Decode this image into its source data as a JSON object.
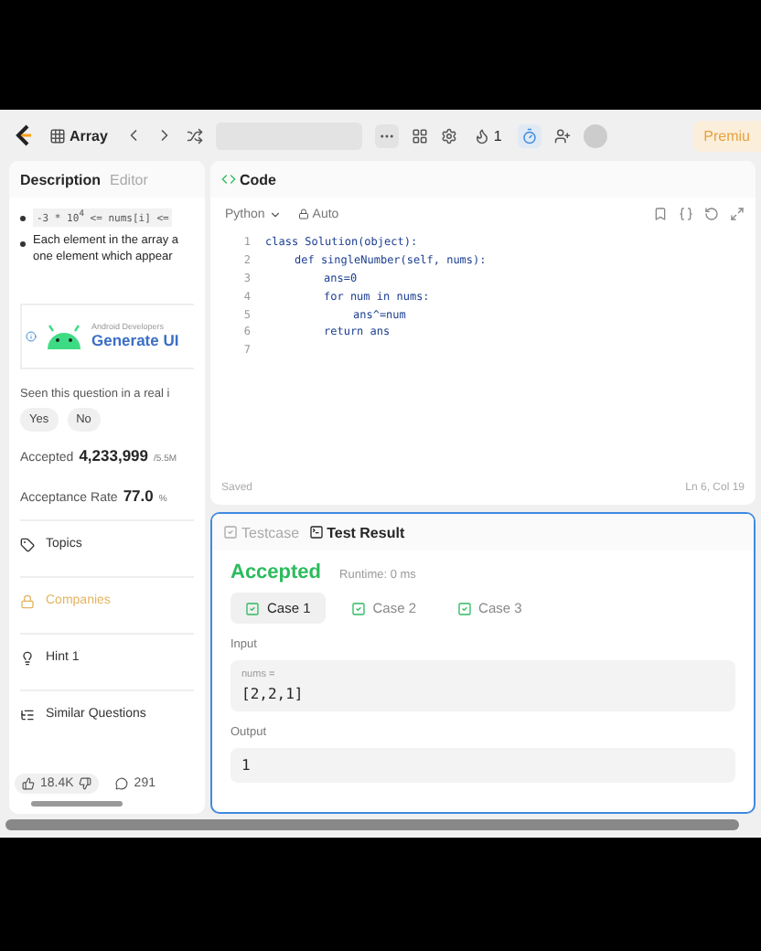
{
  "nav": {
    "problem_list": "Array",
    "streak": "1",
    "premium": "Premiu"
  },
  "left": {
    "tabs": [
      {
        "label": "Description",
        "selected": true
      },
      {
        "label": "Editor",
        "selected": false
      }
    ],
    "constraint": "-3 * 10$^{4}$ <= nums[i] <=",
    "bullet_lines": [
      "Each element in the array a",
      "one element which appear"
    ],
    "ad": {
      "sponsor": "Android Developers",
      "headline": "Generate UI"
    },
    "seen_question": "Seen this question in a real i",
    "answers": [
      "Yes",
      "No"
    ],
    "accepted": {
      "label": "Accepted",
      "value": "4,233,999",
      "total": "/5.5M"
    },
    "acceptance_rate": {
      "label": "Acceptance Rate",
      "value": "77.0",
      "unit": "%"
    },
    "sections": [
      {
        "label": "Topics",
        "kind": "topics",
        "locked": false
      },
      {
        "label": "Companies",
        "kind": "companies",
        "locked": true
      },
      {
        "label": "Hint 1",
        "kind": "hint",
        "locked": false
      },
      {
        "label": "Similar Questions",
        "kind": "similar",
        "locked": false
      }
    ],
    "likes": "18.4K",
    "comments": "291"
  },
  "code": {
    "title": "Code",
    "language": "Python",
    "mode": "Auto",
    "lines": [
      {
        "number": "1",
        "text": "class Solution(object):",
        "children": [
          {
            "number": "2",
            "text": "def singleNumber(self, nums):",
            "children": [
              {
                "number": "3",
                "text": "ans=0"
              },
              {
                "number": "4",
                "text": "for num in nums:",
                "children": [
                  {
                    "number": "5",
                    "text": "ans^=num"
                  }
                ]
              },
              {
                "number": "6",
                "text": "return ans"
              }
            ]
          }
        ]
      },
      {
        "number": "7"
      }
    ],
    "status": "Saved",
    "cursor": "Ln 6, Col 19"
  },
  "result": {
    "tabs": [
      {
        "label": "Testcase",
        "selected": false
      },
      {
        "label": "Test Result",
        "selected": true
      }
    ],
    "verdict": "Accepted",
    "runtime": "Runtime: 0 ms",
    "cases": [
      {
        "label": "Case 1",
        "selected": true
      },
      {
        "label": "Case 2",
        "selected": false
      },
      {
        "label": "Case 3",
        "selected": false
      }
    ],
    "input_label": "Input",
    "param": "nums =",
    "param_value": "[2,2,1]",
    "output_label": "Output",
    "output_value": "1"
  }
}
